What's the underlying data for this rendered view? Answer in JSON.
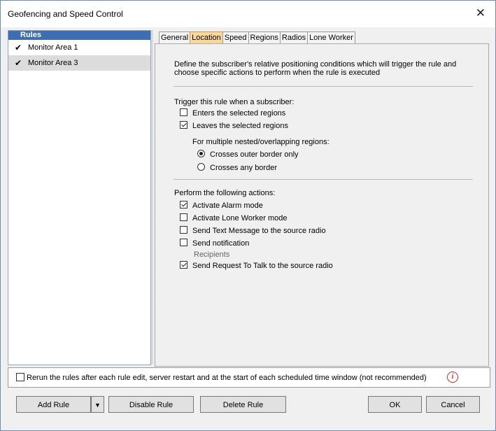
{
  "window": {
    "title": "Geofencing and Speed Control",
    "close_glyph": "✕"
  },
  "rules": {
    "header": "Rules",
    "items": [
      {
        "label": "Monitor Area 1",
        "checked": true
      },
      {
        "label": "Monitor Area 3",
        "checked": true
      }
    ]
  },
  "tabs": [
    {
      "label": "General"
    },
    {
      "label": "Location",
      "active": true
    },
    {
      "label": "Speed"
    },
    {
      "label": "Regions"
    },
    {
      "label": "Radios"
    },
    {
      "label": "Lone Worker"
    }
  ],
  "location": {
    "description": "Define the subscriber's relative positioning conditions which will trigger the rule and choose specific actions to perform when the rule is executed",
    "trigger_heading": "Trigger this rule when a subscriber:",
    "triggers": [
      {
        "label": "Enters the selected regions",
        "checked": false
      },
      {
        "label": "Leaves the selected regions",
        "checked": true
      }
    ],
    "nested_heading": "For multiple nested/overlapping regions:",
    "nested_options": [
      {
        "label": "Crosses outer border only",
        "selected": true
      },
      {
        "label": "Crosses any border",
        "selected": false
      }
    ],
    "actions_heading": "Perform the following actions:",
    "actions": [
      {
        "label": "Activate Alarm mode",
        "checked": true
      },
      {
        "label": "Activate Lone Worker mode",
        "checked": false
      },
      {
        "label": "Send Text Message to the source radio",
        "checked": false
      },
      {
        "label": "Send notification",
        "checked": false
      },
      {
        "label": "Send Request To Talk to the source radio",
        "checked": true
      }
    ],
    "recipients_label": "Recipients"
  },
  "rerun": {
    "label": "Rerun the rules after each rule edit, server restart and at the start of each scheduled time window (not recommended)",
    "checked": false,
    "info_glyph": "i"
  },
  "buttons": {
    "add_rule": "Add Rule",
    "add_rule_dropdown": "▼",
    "disable_rule": "Disable Rule",
    "delete_rule": "Delete Rule",
    "ok": "OK",
    "cancel": "Cancel"
  }
}
